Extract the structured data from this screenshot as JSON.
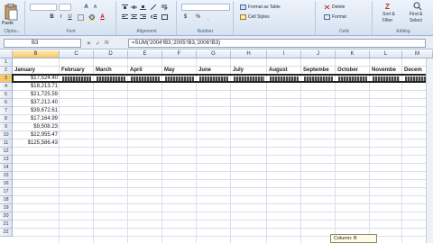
{
  "ribbon": {
    "clipboard": {
      "paste": "Paste",
      "label": "Clipbo..."
    },
    "font": {
      "bold": "B",
      "italic": "I",
      "underline": "U",
      "grow": "A",
      "shrink": "A",
      "color": "A",
      "label": "Font"
    },
    "alignment": {
      "label": "Alignment"
    },
    "number": {
      "currency": "$",
      "percent": "%",
      "label": "Number"
    },
    "styles": {
      "format_table": "Format as Table",
      "cell_styles": "Cell Styles",
      "label": ""
    },
    "cells": {
      "delete": "Delete",
      "format": "Format",
      "label": "Cells"
    },
    "editing": {
      "sort": "Sort &",
      "filter": "Filter",
      "find": "Find &",
      "select": "Select",
      "label": "Editing"
    }
  },
  "formula_bar": {
    "name_box": "B3",
    "fx": "fx",
    "formula": "=SUM('2004'!B3,'2005'!B3,'2006'!B3)"
  },
  "columns": [
    "B",
    "C",
    "D",
    "E",
    "F",
    "G",
    "H",
    "I",
    "J",
    "K",
    "L",
    "M"
  ],
  "active_column": "B",
  "rows": [
    "1",
    "2",
    "3",
    "4",
    "5",
    "6",
    "7",
    "8",
    "9",
    "10",
    "11",
    "12",
    "13",
    "14",
    "15",
    "16",
    "17",
    "18",
    "19",
    "20",
    "21",
    "22"
  ],
  "active_row": "3",
  "headers": [
    "January",
    "February",
    "March",
    "April",
    "May",
    "June",
    "July",
    "August",
    "Septembe",
    "October",
    "Novembe",
    "Decem"
  ],
  "values": [
    "$17,524.40",
    "$18,213.71",
    "$21,725.59",
    "$37,212.40",
    "$39,672.61",
    "$17,164.99",
    "$9,508.23",
    "$22,955.47",
    "$125,586.43"
  ],
  "tooltip": "Column: B",
  "colors": {
    "accent": "#f6c868",
    "hash": "#444444"
  }
}
